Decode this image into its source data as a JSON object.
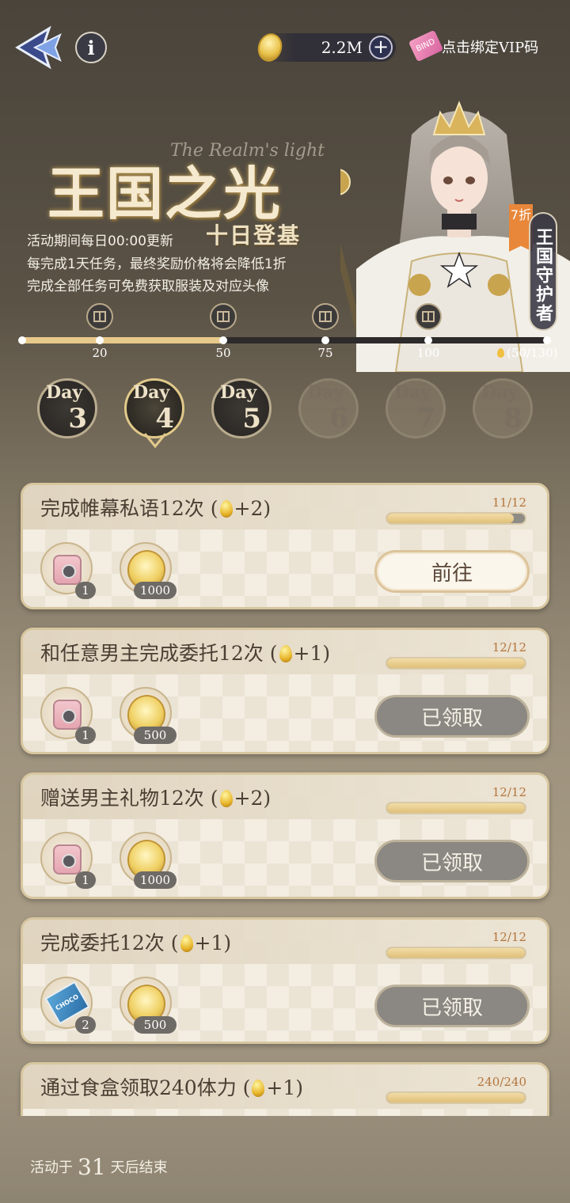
{
  "header": {
    "currency_amount": "2.2M",
    "add_symbol": "+",
    "vip_ticket_text": "BIND",
    "vip_label": "点击绑定VIP码",
    "info_symbol": "i"
  },
  "banner": {
    "title_cn": "王国之光",
    "title_en": "The Realm's light",
    "subtitle": "十日登基",
    "desc_lines": [
      "活动期间每日00:00更新",
      "每完成1天任务，最终奖励价格将会降低1折",
      "完成全部任务可免费获取服装及对应头像"
    ],
    "discount_tag": "7折",
    "guardian_label": "王国守护者"
  },
  "progress": {
    "current": 50,
    "max": 130,
    "total_text": "(50/130)",
    "milestones": [
      "20",
      "50",
      "75",
      "100"
    ]
  },
  "days": {
    "word": "Day",
    "items": [
      {
        "num": "3",
        "state": "done"
      },
      {
        "num": "4",
        "state": "selected"
      },
      {
        "num": "5",
        "state": "done"
      },
      {
        "num": "6",
        "state": "locked"
      },
      {
        "num": "7",
        "state": "locked"
      },
      {
        "num": "8",
        "state": "locked"
      }
    ]
  },
  "tasks": [
    {
      "title": "完成帷幕私语12次 (",
      "bonus": "+2)",
      "count": "11/12",
      "progress": 0.917,
      "rewards": [
        {
          "icon": "camera-icon",
          "qty": "1"
        },
        {
          "icon": "coin-icon",
          "qty": "1000"
        }
      ],
      "button": "前往",
      "state": "go"
    },
    {
      "title": "和任意男主完成委托12次 (",
      "bonus": "+1)",
      "count": "12/12",
      "progress": 1.0,
      "rewards": [
        {
          "icon": "camera-icon",
          "qty": "1"
        },
        {
          "icon": "coin-icon",
          "qty": "500"
        }
      ],
      "button": "已领取",
      "state": "claimed"
    },
    {
      "title": "赠送男主礼物12次 (",
      "bonus": "+2)",
      "count": "12/12",
      "progress": 1.0,
      "rewards": [
        {
          "icon": "camera-icon",
          "qty": "1"
        },
        {
          "icon": "coin-icon",
          "qty": "1000"
        }
      ],
      "button": "已领取",
      "state": "claimed"
    },
    {
      "title": "完成委托12次 (",
      "bonus": "+1)",
      "count": "12/12",
      "progress": 1.0,
      "rewards": [
        {
          "icon": "chocolate-icon",
          "qty": "2"
        },
        {
          "icon": "coin-icon",
          "qty": "500"
        }
      ],
      "button": "已领取",
      "state": "claimed"
    },
    {
      "title": "通过食盒领取240体力 (",
      "bonus": "+1)",
      "count": "240/240",
      "progress": 1.0,
      "rewards": [],
      "button": "",
      "state": "claimed"
    }
  ],
  "reward_labels": {
    "chocolate": "CHOCO"
  },
  "footer": {
    "prefix": "活动于",
    "days": "31",
    "suffix": "天后结束"
  }
}
